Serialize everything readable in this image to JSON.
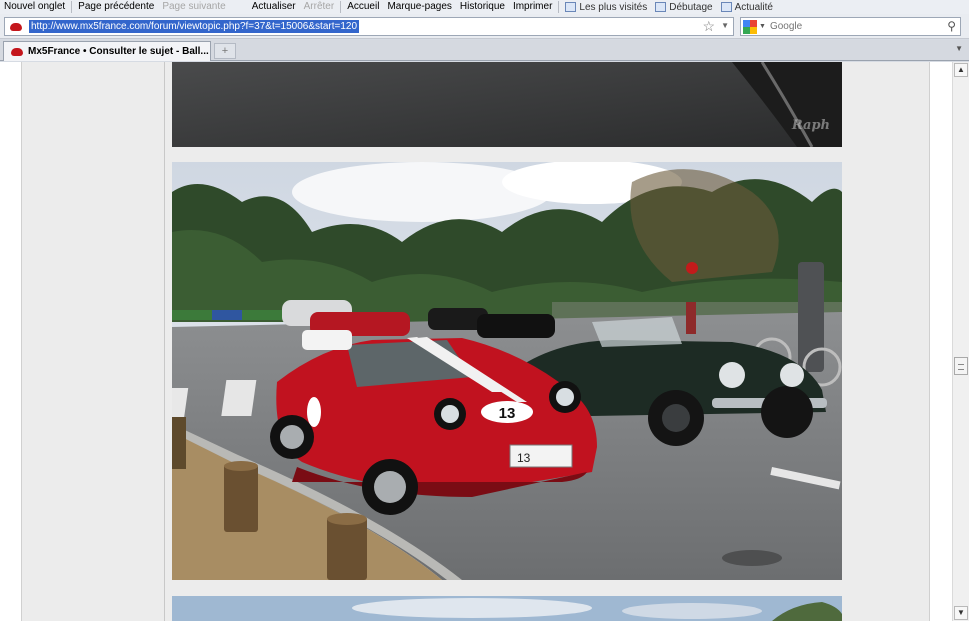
{
  "toolbar": {
    "new_tab": "Nouvel onglet",
    "back": "Page précédente",
    "forward": "Page suivante",
    "reload": "Actualiser",
    "stop": "Arrêter",
    "home": "Accueil",
    "bookmarks": "Marque-pages",
    "history": "Historique",
    "print": "Imprimer",
    "bm_most_visited": "Les plus visités",
    "bm_getting_started": "Débutage",
    "bm_news": "Actualité"
  },
  "address_bar": {
    "url": "http://www.mx5france.com/forum/viewtopic.php?f=37&t=15006&start=120",
    "star_icon": "bookmark-star-icon"
  },
  "search_bar": {
    "engine_icon": "google-icon",
    "placeholder": "Google",
    "value": ""
  },
  "tabs": [
    {
      "title": "Mx5France • Consulter le sujet - Ball...",
      "favicon": "mx5-logo-icon"
    }
  ],
  "new_tab_symbol": "+",
  "content": {
    "watermark": "Raph",
    "car_plate": "13",
    "car_number": "13"
  },
  "colors": {
    "url_selection": "#3366cc",
    "page_background": "#ececec",
    "car_red": "#c1121f"
  }
}
